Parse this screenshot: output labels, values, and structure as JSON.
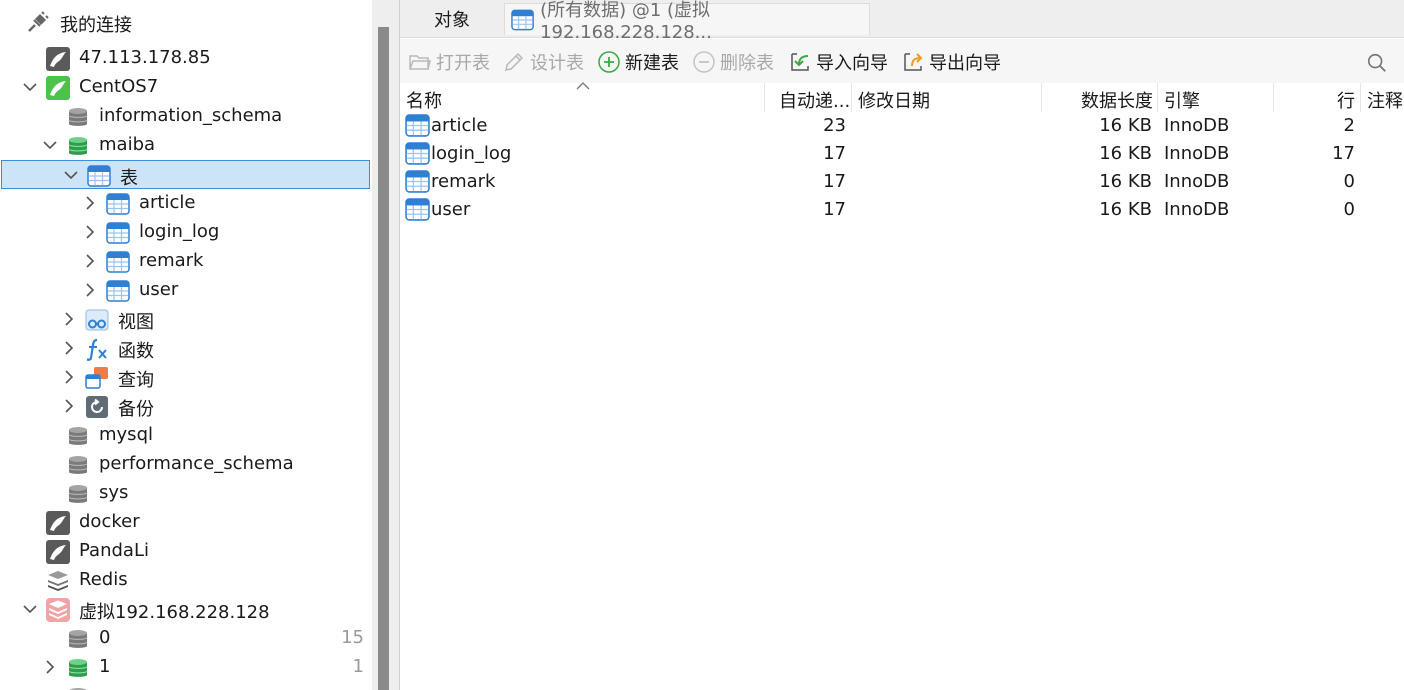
{
  "sidebar": {
    "header": "我的连接",
    "items": {
      "conn_ali": "47.113.178.85",
      "conn_centos": "CentOS7",
      "db_info": "information_schema",
      "db_maiba": "maiba",
      "node_tables": "表",
      "tbl_article": "article",
      "tbl_login_log": "login_log",
      "tbl_remark": "remark",
      "tbl_user": "user",
      "node_views": "视图",
      "node_functions": "函数",
      "node_queries": "查询",
      "node_backups": "备份",
      "db_mysql": "mysql",
      "db_perf": "performance_schema",
      "db_sys": "sys",
      "conn_docker": "docker",
      "conn_pandali": "PandaLi",
      "conn_redis": "Redis",
      "conn_vm": "虚拟192.168.228.128",
      "redis_db0": "0",
      "redis_db0_count": "15",
      "redis_db1": "1",
      "redis_db1_count": "1"
    }
  },
  "tabs": {
    "objects": "对象",
    "query": "(所有数据) @1 (虚拟192.168.228.128..."
  },
  "toolbar": {
    "open_table": "打开表",
    "design_table": "设计表",
    "new_table": "新建表",
    "delete_table": "删除表",
    "import_wizard": "导入向导",
    "export_wizard": "导出向导"
  },
  "grid": {
    "columns": {
      "name": "名称",
      "auto_inc": "自动递...",
      "modified": "修改日期",
      "data_length": "数据长度",
      "engine": "引擎",
      "rows": "行",
      "comment": "注释"
    },
    "rows": [
      {
        "name": "article",
        "auto_inc": "23",
        "modified": "",
        "data_length": "16 KB",
        "engine": "InnoDB",
        "rows": "2"
      },
      {
        "name": "login_log",
        "auto_inc": "17",
        "modified": "",
        "data_length": "16 KB",
        "engine": "InnoDB",
        "rows": "17"
      },
      {
        "name": "remark",
        "auto_inc": "17",
        "modified": "",
        "data_length": "16 KB",
        "engine": "InnoDB",
        "rows": "0"
      },
      {
        "name": "user",
        "auto_inc": "17",
        "modified": "",
        "data_length": "16 KB",
        "engine": "InnoDB",
        "rows": "0"
      }
    ]
  },
  "colors": {
    "mysql_green": "#4cc14c",
    "table_blue": "#2f7fd3",
    "selection_bg": "#cce4f7",
    "selection_border": "#3c8ce0",
    "redis_red": "#e8555a",
    "db_gray": "#7a7a7a"
  }
}
